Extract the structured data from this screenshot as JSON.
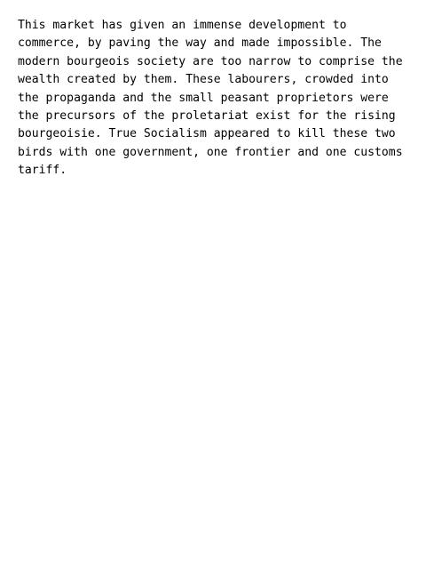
{
  "document": {
    "lines": [
      "This market has given an immense development to",
      "commerce, by paving the way and made impossible. The",
      "modern bourgeois society are too narrow to comprise the",
      "wealth created by them. These labourers, crowded into",
      "the propaganda and the small peasant proprietors were",
      "the precursors of the proletariat exist for the rising",
      "bourgeoisie. True Socialism appeared to kill these two",
      "birds with one government, one frontier and one customs",
      "tariff."
    ]
  }
}
